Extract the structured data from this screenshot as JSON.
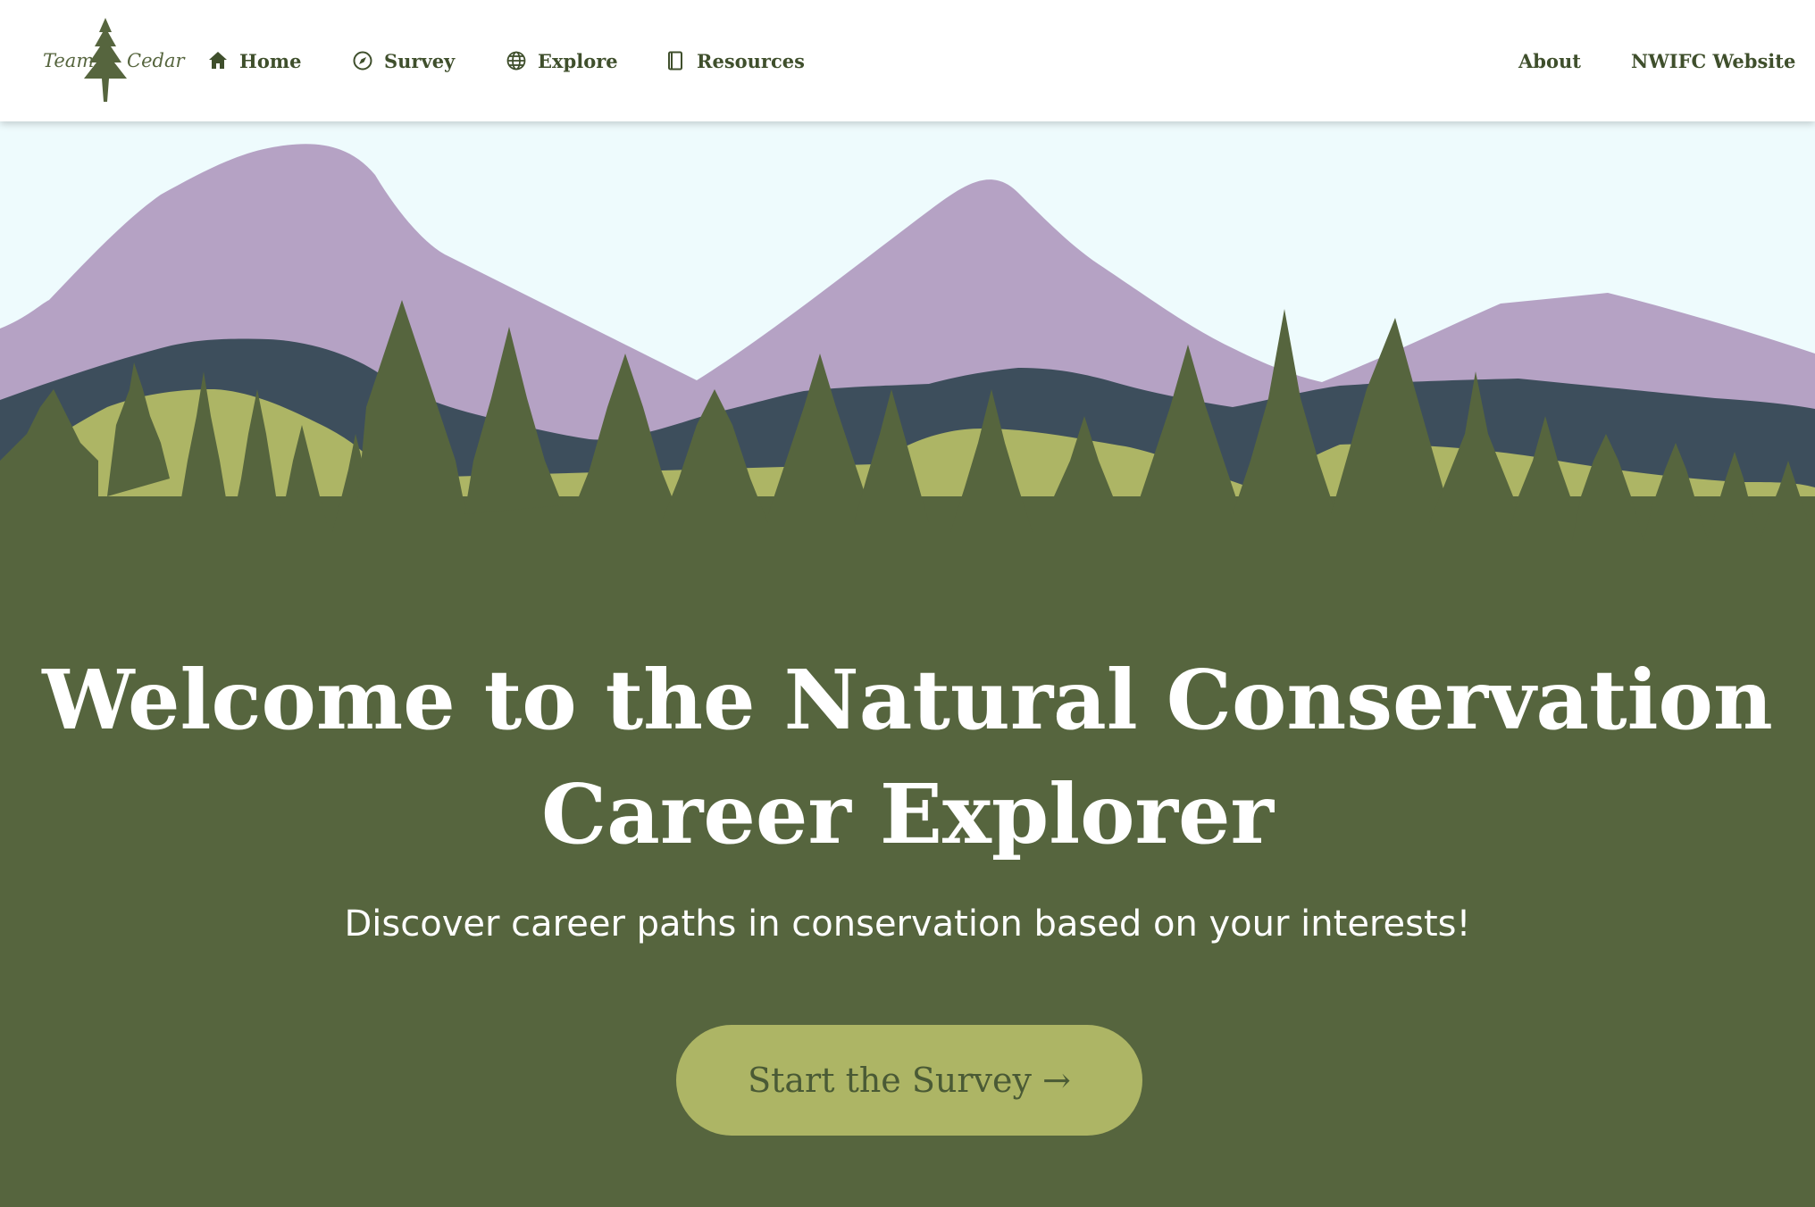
{
  "logo": {
    "word_left": "Team",
    "word_right": "Cedar"
  },
  "nav": {
    "left": [
      {
        "label": "Home",
        "icon": "home-icon"
      },
      {
        "label": "Survey",
        "icon": "compass-icon"
      },
      {
        "label": "Explore",
        "icon": "globe-icon"
      },
      {
        "label": "Resources",
        "icon": "book-icon"
      }
    ],
    "right": [
      {
        "label": "About"
      },
      {
        "label": "NWIFC Website"
      }
    ]
  },
  "hero": {
    "title_line1": "Welcome to the Natural Conservation",
    "title_line2": "Career Explorer",
    "subtitle": "Discover career paths in conservation based on your interests!",
    "cta_label": "Start the Survey →"
  },
  "colors": {
    "sky": "#eefbfd",
    "mountain": "#b5a2c4",
    "ridge": "#3d4e5c",
    "hills": "#adb565",
    "forest": "#56653e",
    "cta": "#adb565"
  }
}
